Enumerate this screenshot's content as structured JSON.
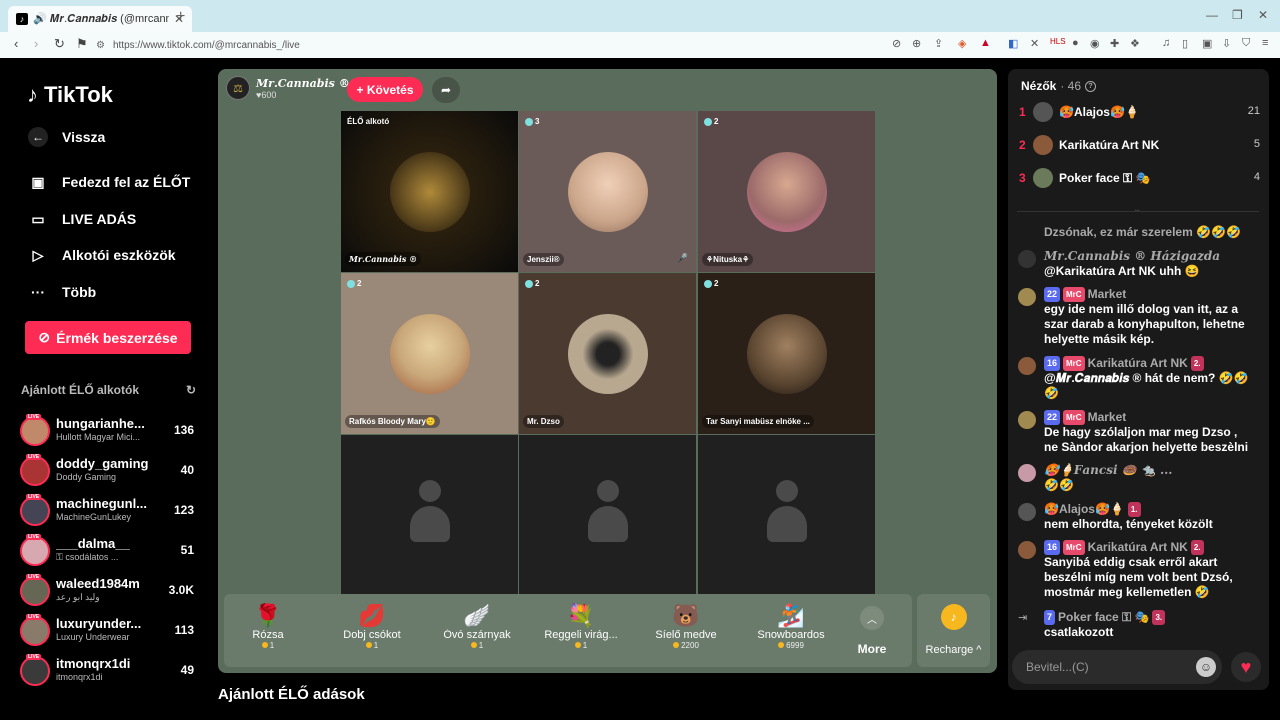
{
  "browser": {
    "tab_title": "🔊 𝑴𝒓.𝑪𝒂𝒏𝒏𝒂𝒃𝒊𝒔 (@mrcann",
    "url": "https://www.tiktok.com/@mrcannabis_/live"
  },
  "sidebar": {
    "logo_text": "TikTok",
    "back_label": "Vissza",
    "items": [
      {
        "label": "Fedezd fel az ÉLŐT",
        "icon": "calendar-live-icon"
      },
      {
        "label": "LIVE ADÁS",
        "icon": "camera-icon"
      },
      {
        "label": "Alkotói eszközök",
        "icon": "play-circle-icon"
      },
      {
        "label": "Több",
        "icon": "more-dots-icon"
      }
    ],
    "coins_button": "Érmék beszerzése",
    "recommended_title": "Ajánlott ÉLŐ alkotók",
    "live_badge": "LIVE",
    "creators": [
      {
        "name": "hungarianhe...",
        "sub": "Hullott Magyar Mici...",
        "count": "136"
      },
      {
        "name": "doddy_gaming",
        "sub": "Doddy Gaming",
        "count": "40"
      },
      {
        "name": "machinegunl...",
        "sub": "MachineGunLukey",
        "count": "123"
      },
      {
        "name": "___dalma__",
        "sub": "⚿ csodálatos ...",
        "count": "51"
      },
      {
        "name": "waleed1984m",
        "sub": "وليد ابو رعد",
        "count": "3.0K"
      },
      {
        "name": "luxuryunder...",
        "sub": "Luxury Underwear",
        "count": "113"
      },
      {
        "name": "itmonqrx1di",
        "sub": "itmonqrx1di",
        "count": "49"
      }
    ]
  },
  "stream": {
    "host_name": "𝑴𝒓.𝑪𝒂𝒏𝒏𝒂𝒃𝒊𝒔 ®",
    "host_likes": "♥600",
    "follow_label": "+ Követés",
    "guests": [
      {
        "badge": "ÉLŐ alkotó",
        "label": "𝑴𝒓.𝑪𝒂𝒏𝒏𝒂𝒃𝒊𝒔 ®",
        "color": "#b08a3a"
      },
      {
        "badge": "3",
        "label": "Jenszii®",
        "color": "#caa58a"
      },
      {
        "badge": "2",
        "label": "⚘Nituska⚘",
        "color": "#9b6a6a"
      },
      {
        "badge": "2",
        "label": "Rafkós Bloody Mary🙂",
        "color": "#c9a87a"
      },
      {
        "badge": "2",
        "label": "Mr. Dzso",
        "color": "#b8a890"
      },
      {
        "badge": "2",
        "label": "Tar Sanyi mabüsz elnöke ...",
        "color": "#5a4530"
      }
    ],
    "gifts": [
      {
        "name": "Rózsa",
        "price": "1",
        "icon": "🌹"
      },
      {
        "name": "Dobj csókot",
        "price": "1",
        "icon": "💋"
      },
      {
        "name": "Óvó szárnyak",
        "price": "1",
        "icon": "🪽"
      },
      {
        "name": "Reggeli virág...",
        "price": "1",
        "icon": "💐"
      },
      {
        "name": "Síelő medve",
        "price": "2200",
        "icon": "🐻"
      },
      {
        "name": "Snowboardos",
        "price": "6999",
        "icon": "🏂"
      }
    ],
    "more_label": "More",
    "recharge_label": "Recharge ^",
    "below_title": "Ajánlott ÉLŐ adások"
  },
  "chat": {
    "viewers_title": "Nézők",
    "viewers_count": "· 46",
    "top_viewers": [
      {
        "rank": "1",
        "name": "🥵Alajos🥵🍦",
        "score": "21"
      },
      {
        "rank": "2",
        "name": "Karikatúra Art NK",
        "score": "5"
      },
      {
        "rank": "3",
        "name": "Poker face ⚿ 🎭",
        "score": "4"
      }
    ],
    "messages": [
      {
        "head": "",
        "text": "Dzsónak, ez már szerelem 🤣🤣🤣"
      },
      {
        "head": "𝑴𝒓.𝑪𝒂𝒏𝒏𝒂𝒃𝒊𝒔 ® Házigazda",
        "text": "@Karikatúra Art NK uhh 😆"
      },
      {
        "lvl": "22",
        "fan": "MrC",
        "name": "Market",
        "text": "egy ide nem illő dolog van itt, az a szar darab a konyhapulton, lehetne helyette másik kép."
      },
      {
        "lvl": "16",
        "fan": "MrC",
        "name": "Karikatúra Art NK",
        "rk": "2.",
        "text": "@𝑴𝒓.𝑪𝒂𝒏𝒏𝒂𝒃𝒊𝒔 ® hát de nem? 🤣🤣🤣"
      },
      {
        "lvl": "22",
        "fan": "MrC",
        "name": "Market",
        "text": "De hagy szólaljon mar meg Dzso , ne Sàndor akarjon helyette beszèlni"
      },
      {
        "head": "🥵🍦𝑭𝒂𝒏𝒄𝒔𝒊 🍩 🐀 ...",
        "text": "🤣🤣"
      },
      {
        "name": "🥵Alajos🥵🍦",
        "rk": "1.",
        "text": "nem elhordta, tényeket közölt"
      },
      {
        "lvl": "16",
        "fan": "MrC",
        "name": "Karikatúra Art NK",
        "rk": "2.",
        "text": "Sanyibá eddig csak erről akart beszélni míg nem volt bent Dzsó, mostmár meg kellemetlen 🤣"
      },
      {
        "lvl": "7",
        "name": "Poker face ⚿ 🎭",
        "rk": "3.",
        "text": "csatlakozott"
      }
    ],
    "input_placeholder": "Bevitel...(C)"
  },
  "colors": {
    "accent": "#fe2c55",
    "stage_bg": "#5a6c5b",
    "chat_bg": "#1a1a1a"
  }
}
